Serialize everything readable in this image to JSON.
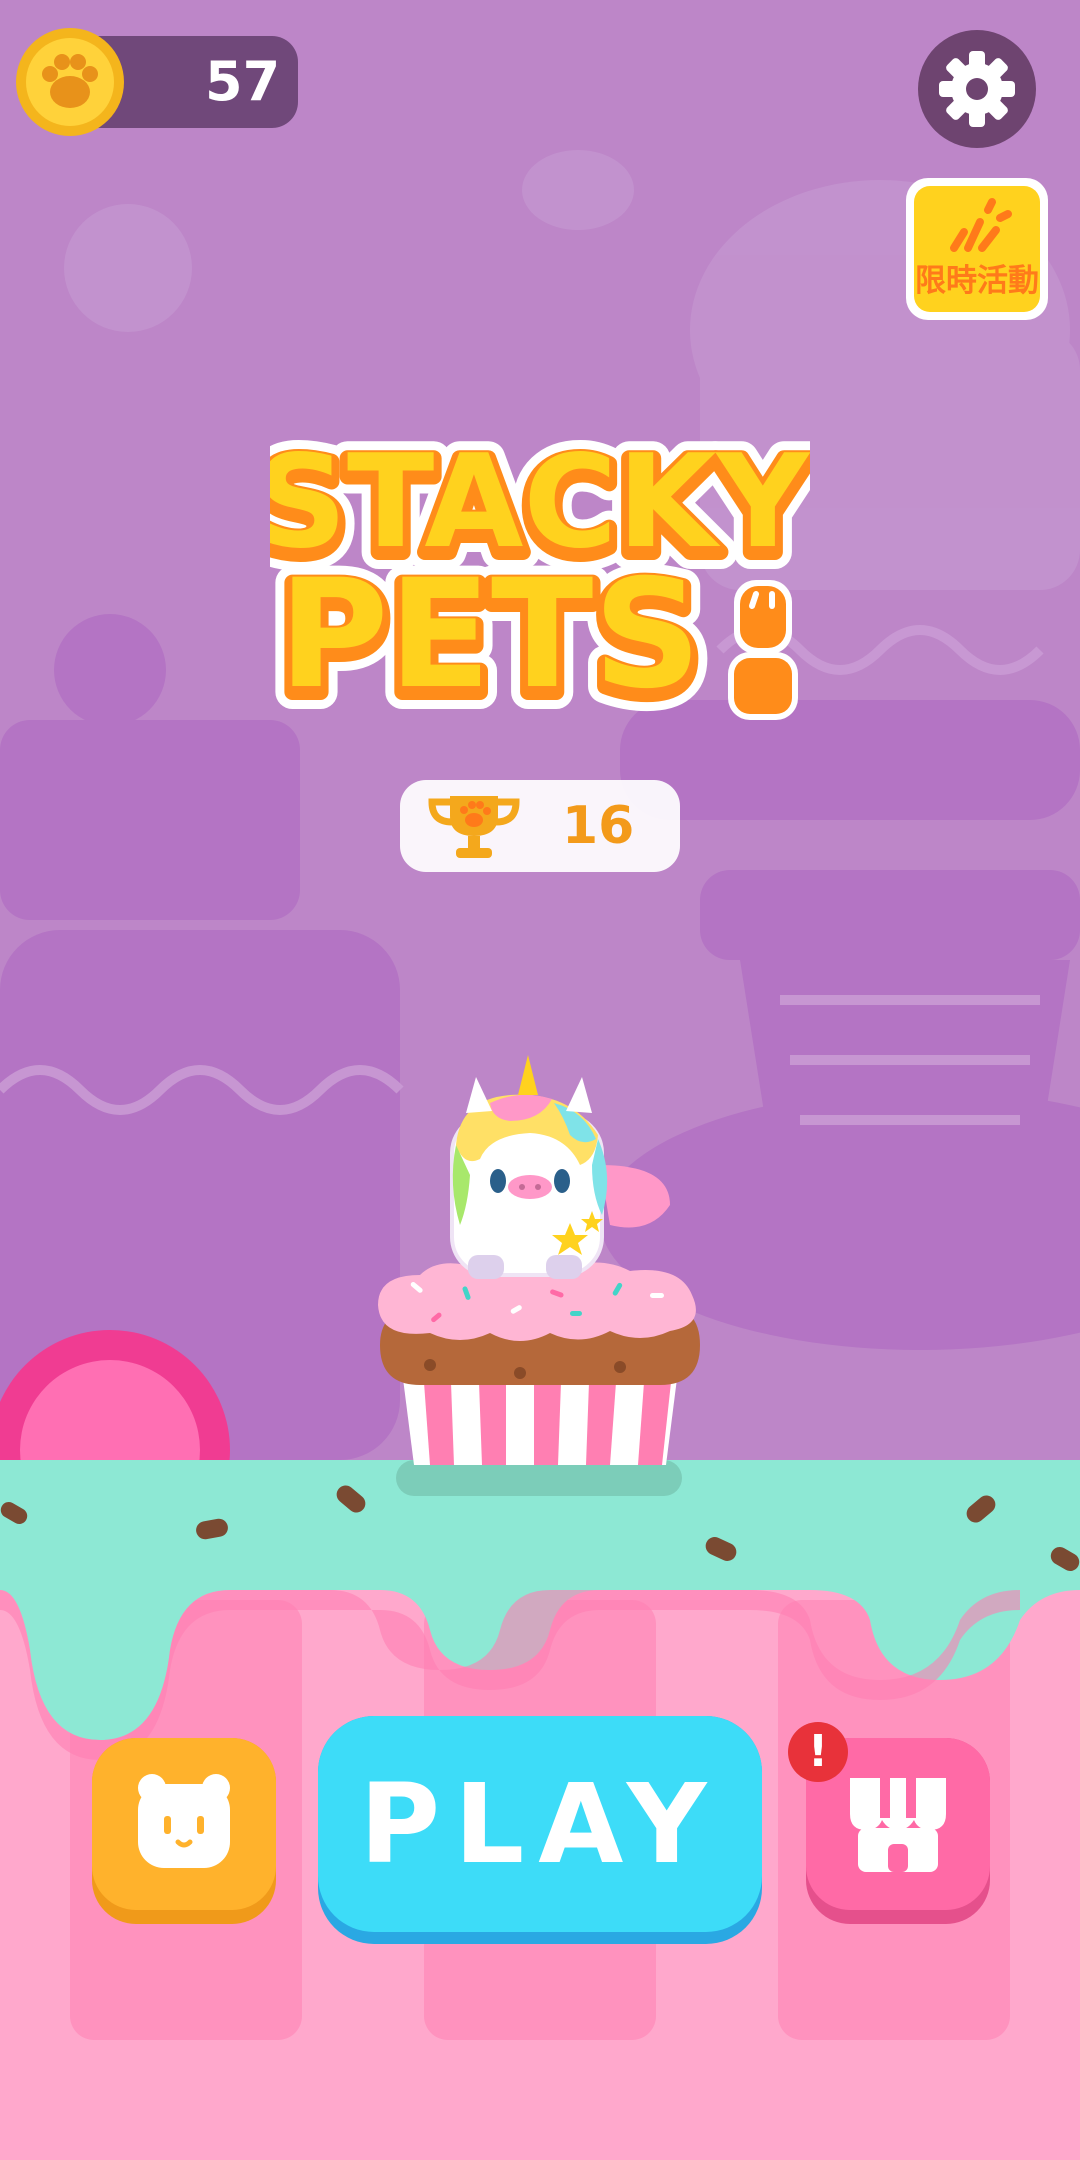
{
  "app": {
    "title": "STACKY",
    "title_line2": "PETS"
  },
  "hud": {
    "coins": "57",
    "best_score": "16"
  },
  "event_button": {
    "label": "限時活動"
  },
  "play_button": {
    "label": "PLAY"
  },
  "pets_button": {
    "icon": "bear-face-icon"
  },
  "shop_button": {
    "icon": "shop-icon",
    "alert": "!"
  },
  "colors": {
    "sky": "#bd86c8",
    "mint": "#8de8d4",
    "pink": "#ffa8cc",
    "play": "#3ddcf8",
    "pets": "#ffb22c",
    "shop": "#ff6aa6"
  }
}
